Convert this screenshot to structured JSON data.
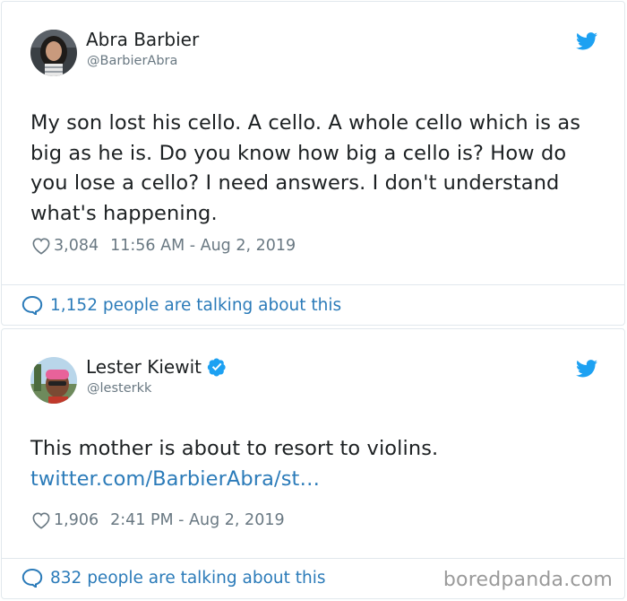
{
  "tweets": [
    {
      "name": "Abra Barbier",
      "handle": "@BarbierAbra",
      "verified": false,
      "text": "My son lost his cello. A cello. A whole cello which is as big as he is. Do you know how big a cello is? How do you lose a cello? I need answers. I don't understand what's happening.",
      "link": "",
      "likes": "3,084",
      "timestamp": "11:56 AM - Aug 2, 2019",
      "talking": "1,152 people are talking about this"
    },
    {
      "name": "Lester Kiewit",
      "handle": "@lesterkk",
      "verified": true,
      "text": "This mother is about to resort to violins.",
      "link": "twitter.com/BarbierAbra/st…",
      "likes": "1,906",
      "timestamp": "2:41 PM - Aug 2, 2019",
      "talking": "832 people are talking about this"
    }
  ],
  "watermark": "boredpanda.com",
  "icons": {
    "bird": "twitter-bird-icon",
    "heart": "heart-icon",
    "bubble": "comment-bubble-icon",
    "verified": "verified-badge-icon"
  },
  "colors": {
    "twitter_blue": "#1da1f2",
    "link": "#2b7bb9",
    "muted": "#697882"
  }
}
